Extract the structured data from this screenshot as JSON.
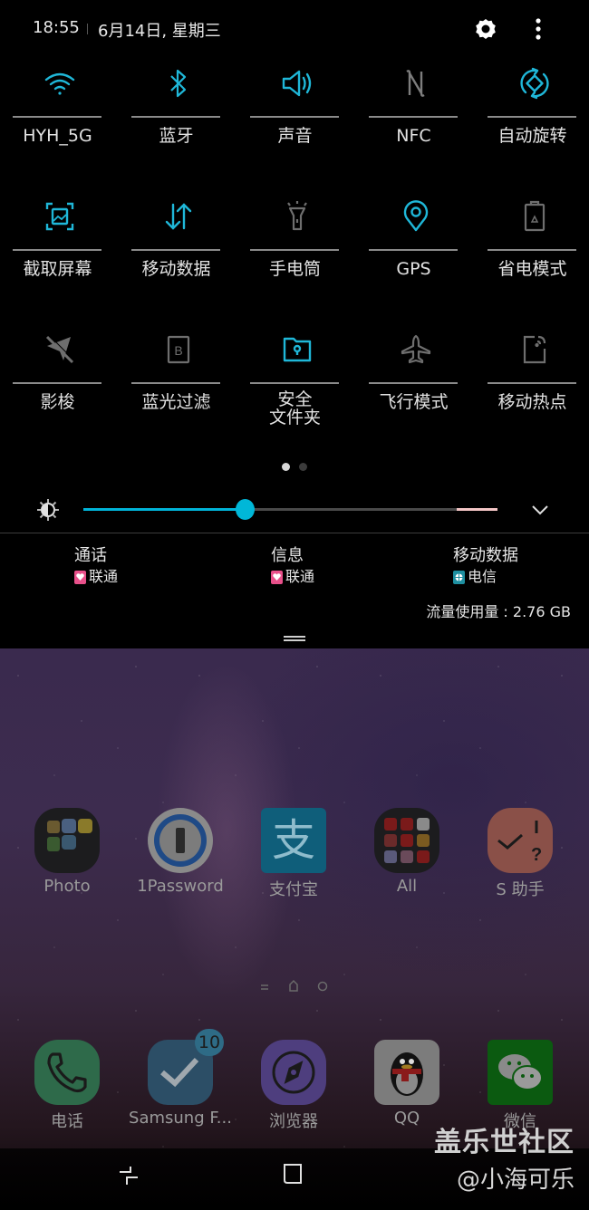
{
  "status_bar": {
    "time": "18:55",
    "date": "6月14日, 星期三",
    "settings_icon": "gear-icon",
    "more_icon": "more-vertical-icon"
  },
  "quick_settings": {
    "active_color": "#1fb7d8",
    "inactive_color": "#8a8a8a",
    "tiles": [
      {
        "label": "HYH_5G",
        "icon": "wifi-icon",
        "active": true
      },
      {
        "label": "蓝牙",
        "icon": "bluetooth-icon",
        "active": true
      },
      {
        "label": "声音",
        "icon": "sound-icon",
        "active": true
      },
      {
        "label": "NFC",
        "icon": "nfc-icon",
        "active": false
      },
      {
        "label": "自动旋转",
        "icon": "auto-rotate-icon",
        "active": true
      },
      {
        "label": "截取屏幕",
        "icon": "screenshot-icon",
        "active": true
      },
      {
        "label": "移动数据",
        "icon": "mobile-data-icon",
        "active": true
      },
      {
        "label": "手电筒",
        "icon": "flashlight-icon",
        "active": false
      },
      {
        "label": "GPS",
        "icon": "location-icon",
        "active": true
      },
      {
        "label": "省电模式",
        "icon": "battery-saver-icon",
        "active": false
      },
      {
        "label": "影梭",
        "icon": "shadowsocks-icon",
        "active": false
      },
      {
        "label": "蓝光过滤",
        "icon": "blue-light-filter-icon",
        "active": false
      },
      {
        "label": "安全\n文件夹",
        "label_line1": "安全",
        "label_line2": "文件夹",
        "icon": "secure-folder-icon",
        "active": true
      },
      {
        "label": "飞行模式",
        "icon": "airplane-icon",
        "active": false
      },
      {
        "label": "移动热点",
        "icon": "hotspot-icon",
        "active": false
      }
    ],
    "page_indicator": {
      "current": 1,
      "total": 2
    }
  },
  "brightness": {
    "icon": "brightness-icon",
    "level_fraction": 0.39,
    "expand_icon": "chevron-down-icon"
  },
  "sim_info": {
    "call": {
      "title": "通话",
      "carrier": "联通",
      "badge_color": "#e8508a"
    },
    "message": {
      "title": "信息",
      "carrier": "联通",
      "badge_color": "#e8508a"
    },
    "mobile_data": {
      "title": "移动数据",
      "carrier": "电信",
      "badge_color": "#1e8fa0"
    },
    "data_usage": "流量使用量 : 2.76 GB"
  },
  "home_screen": {
    "apps": [
      {
        "name": "Photo",
        "icon": "photo-folder-icon"
      },
      {
        "name": "1Password",
        "icon": "1password-icon"
      },
      {
        "name": "支付宝",
        "icon": "alipay-icon"
      },
      {
        "name": "All",
        "icon": "all-folder-icon"
      },
      {
        "name": "S 助手",
        "icon": "s-assistant-icon"
      }
    ],
    "dock": [
      {
        "name": "电话",
        "icon": "phone-icon"
      },
      {
        "name": "Samsung F...",
        "icon": "samsung-flow-icon",
        "badge": "10"
      },
      {
        "name": "浏览器",
        "icon": "browser-icon"
      },
      {
        "name": "QQ",
        "icon": "qq-icon"
      },
      {
        "name": "微信",
        "icon": "wechat-icon"
      }
    ]
  },
  "navigation": {
    "recent_icon": "recent-apps-icon",
    "home_icon": "home-icon"
  },
  "watermark": {
    "line1": "盖乐世社区",
    "line2": "@小海可乐"
  }
}
